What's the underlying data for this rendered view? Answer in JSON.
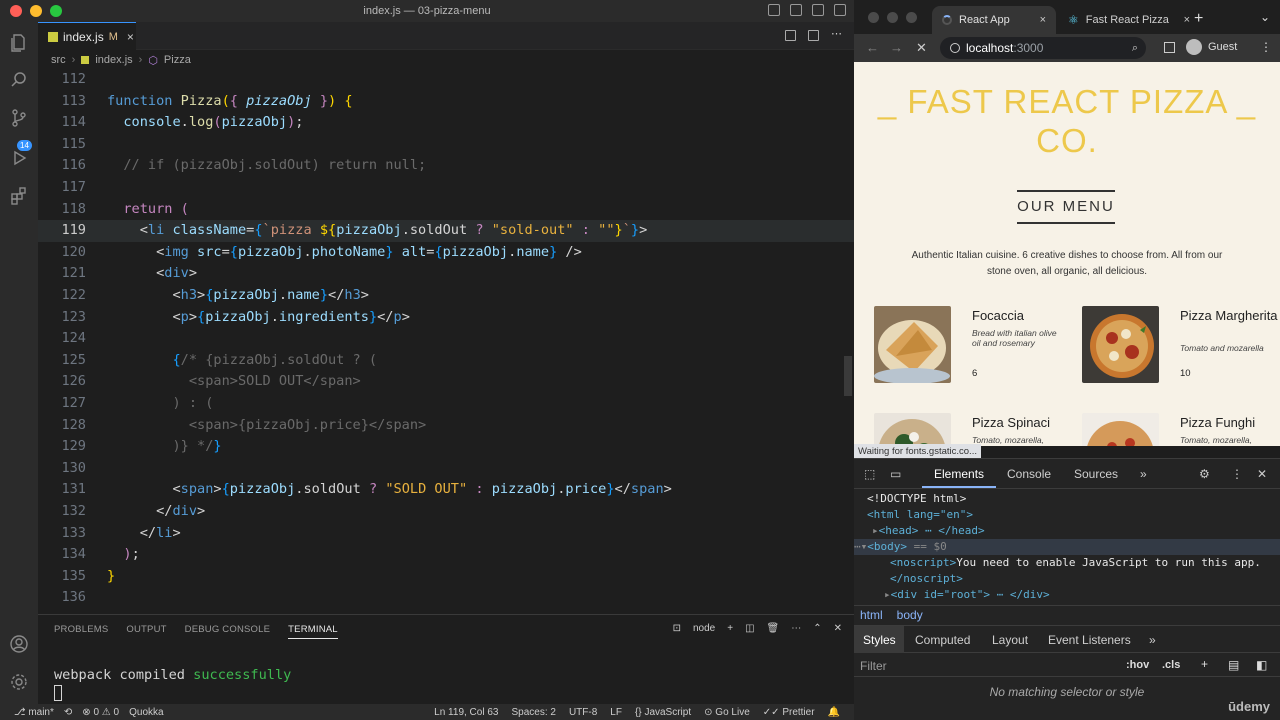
{
  "vscode": {
    "window_title": "index.js — 03-pizza-menu",
    "tab": {
      "filename": "index.js",
      "modified_marker": "M",
      "close": "×"
    },
    "breadcrumb": {
      "folder": "src",
      "file": "index.js",
      "symbol": "Pizza"
    },
    "activity_badge": "14",
    "code_lines": [
      {
        "n": "112"
      },
      {
        "n": "113"
      },
      {
        "n": "114"
      },
      {
        "n": "115"
      },
      {
        "n": "116"
      },
      {
        "n": "117"
      },
      {
        "n": "118"
      },
      {
        "n": "119"
      },
      {
        "n": "120"
      },
      {
        "n": "121"
      },
      {
        "n": "122"
      },
      {
        "n": "123"
      },
      {
        "n": "124"
      },
      {
        "n": "125"
      },
      {
        "n": "126"
      },
      {
        "n": "127"
      },
      {
        "n": "128"
      },
      {
        "n": "129"
      },
      {
        "n": "130"
      },
      {
        "n": "131"
      },
      {
        "n": "132"
      },
      {
        "n": "133"
      },
      {
        "n": "134"
      },
      {
        "n": "135"
      },
      {
        "n": "136"
      }
    ],
    "panel": {
      "tabs": [
        "PROBLEMS",
        "OUTPUT",
        "DEBUG CONSOLE",
        "TERMINAL"
      ],
      "active_tab": "TERMINAL",
      "shell": "node",
      "terminal_prefix": "webpack compiled ",
      "terminal_ok": "successfully"
    },
    "status": {
      "branch": "main*",
      "errors": "0",
      "warnings": "0",
      "quokka": "Quokka",
      "position": "Ln 119, Col 63",
      "spaces": "Spaces: 2",
      "encoding": "UTF-8",
      "eol": "LF",
      "language": "JavaScript",
      "golive": "Go Live",
      "prettier": "Prettier"
    }
  },
  "chrome": {
    "tabs": [
      {
        "title": "React App",
        "close": "×"
      },
      {
        "title": "Fast React Pizza",
        "close": "×"
      }
    ],
    "new_tab": "+",
    "address": {
      "host": "localhost",
      "port": ":3000"
    },
    "profile": "Guest",
    "page": {
      "brand": "_ FAST REACT PIZZA _ CO.",
      "menu_heading": "OUR MENU",
      "intro": "Authentic Italian cuisine. 6 creative dishes to choose from. All from our stone oven, all organic, all delicious.",
      "pizzas": [
        {
          "name": "Focaccia",
          "ingredients": "Bread with italian olive oil and rosemary",
          "price": "6"
        },
        {
          "name": "Pizza Margherita",
          "ingredients": "Tomato and mozarella",
          "price": "10"
        },
        {
          "name": "Pizza Spinaci",
          "ingredients": "Tomato, mozarella, spinach, and ricotta",
          "price": ""
        },
        {
          "name": "Pizza Funghi",
          "ingredients": "Tomato, mozarella, mushrooms, and",
          "price": ""
        }
      ]
    },
    "status_bubble": "Waiting for fonts.gstatic.co...",
    "devtools": {
      "tabs": [
        "Elements",
        "Console",
        "Sources"
      ],
      "more": "»",
      "dom": {
        "doctype": "<!DOCTYPE html>",
        "html_open": "<html lang=\"en\">",
        "head": "<head> ⋯ </head>",
        "body_sel": "== $0",
        "noscript_text": "You need to enable JavaScript to run this app.",
        "noscript_close": "</noscript>",
        "div_root": "<div id=\"root\"> ⋯ </div>"
      },
      "crumbs": [
        "html",
        "body"
      ],
      "style_tabs": [
        "Styles",
        "Computed",
        "Layout",
        "Event Listeners"
      ],
      "filter_placeholder": "Filter",
      "hov": ":hov",
      "cls": ".cls",
      "no_match": "No matching selector or style"
    },
    "watermark": "ūdemy"
  }
}
